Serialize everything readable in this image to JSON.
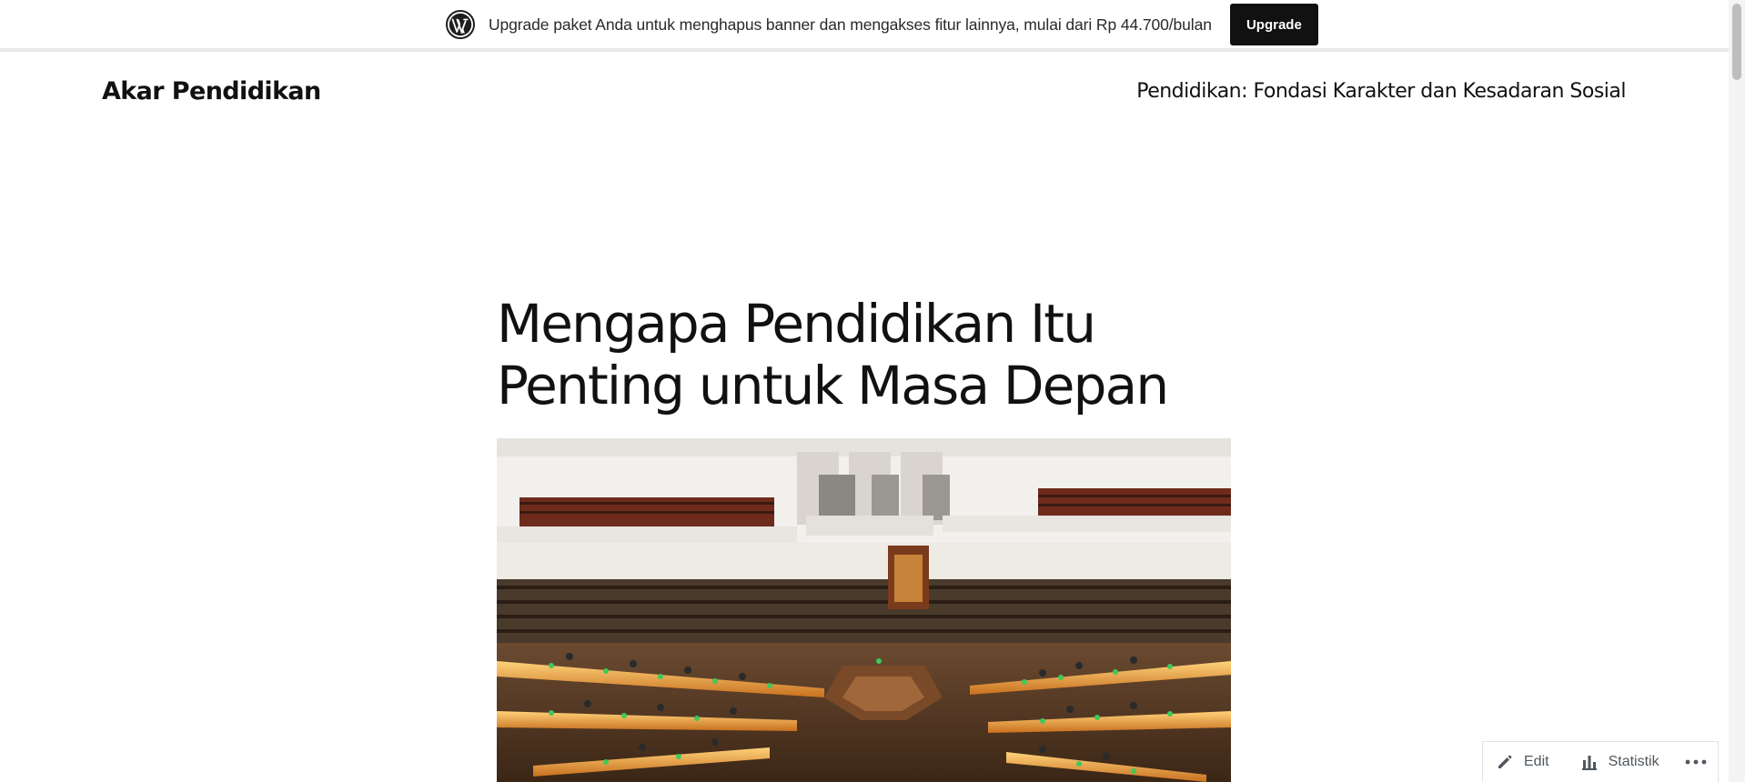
{
  "banner": {
    "text": "Upgrade paket Anda untuk menghapus banner dan mengakses fitur lainnya, mulai dari Rp 44.700/bulan",
    "button_label": "Upgrade",
    "logo_icon": "wordpress-logo-icon"
  },
  "header": {
    "site_title": "Akar Pendidikan",
    "tagline": "Pendidikan: Fondasi Karakter dan Kesadaran Sosial"
  },
  "post": {
    "title": "Mengapa Pendidikan Itu Penting untuk Masa Depan",
    "featured_image": "library-reading-room-photo"
  },
  "admin_bar": {
    "edit_label": "Edit",
    "edit_icon": "pencil-icon",
    "stats_label": "Statistik",
    "stats_icon": "bar-chart-icon",
    "more_icon": "ellipsis-icon"
  },
  "colors": {
    "button_bg": "#111111",
    "text": "#111111",
    "admin_text": "#50575e"
  }
}
